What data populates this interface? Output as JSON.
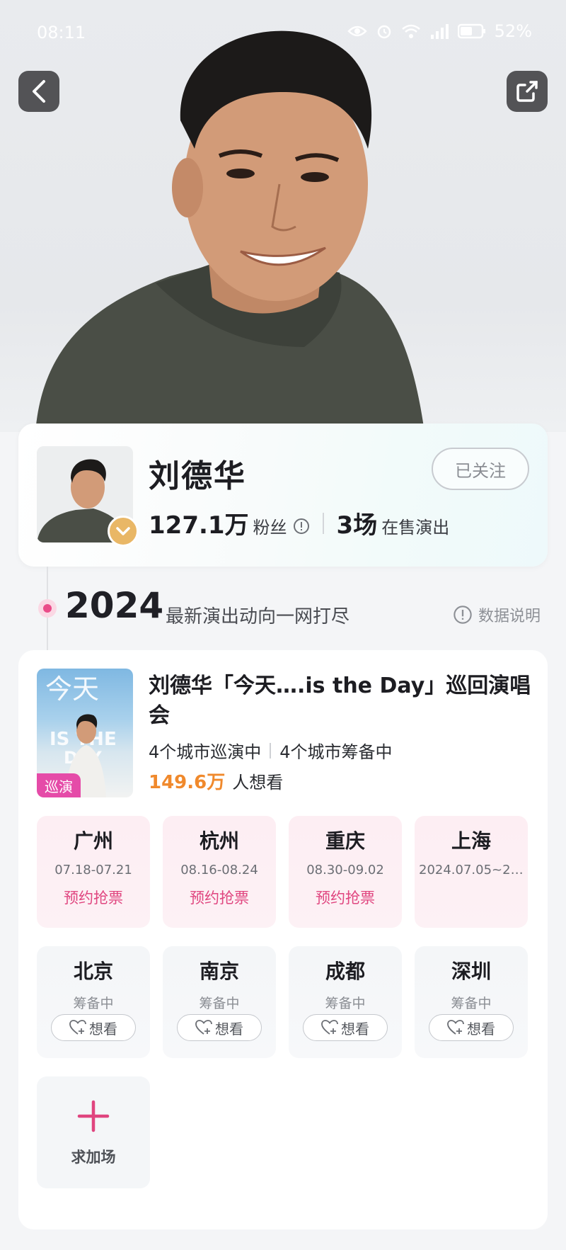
{
  "status_bar": {
    "time": "08:11",
    "battery": "52%"
  },
  "nav": {
    "back_icon": "chevron-left-icon",
    "share_icon": "share-icon"
  },
  "profile": {
    "name": "刘德华",
    "follow_label": "已关注",
    "fans_count": "127.1万",
    "fans_label": "粉丝",
    "shows_count": "3场",
    "shows_label": "在售演出"
  },
  "timeline": {
    "year": "2024",
    "subtitle": "最新演出动向一网打尽",
    "data_note": "数据说明"
  },
  "event": {
    "title": "刘德华「今天….is the Day」巡回演唱会",
    "tour_tag": "巡演",
    "touring": "4个城市巡演中",
    "preparing": "4个城市筹备中",
    "want_count": "149.6万",
    "want_label": "人想看",
    "cities_on_sale": [
      {
        "name": "广州",
        "date": "07.18-07.21",
        "action": "预约抢票"
      },
      {
        "name": "杭州",
        "date": "08.16-08.24",
        "action": "预约抢票"
      },
      {
        "name": "重庆",
        "date": "08.30-09.02",
        "action": "预约抢票"
      },
      {
        "name": "上海",
        "date": "2024.07.05~202...",
        "action": ""
      }
    ],
    "cities_planning": [
      {
        "name": "北京",
        "status": "筹备中",
        "button": "想看"
      },
      {
        "name": "南京",
        "status": "筹备中",
        "button": "想看"
      },
      {
        "name": "成都",
        "status": "筹备中",
        "button": "想看"
      },
      {
        "name": "深圳",
        "status": "筹备中",
        "button": "想看"
      }
    ],
    "add_show_label": "求加场"
  },
  "colors": {
    "accent_pink": "#e0457f",
    "want_orange": "#f0892c",
    "badge_gold": "#e9b766"
  }
}
